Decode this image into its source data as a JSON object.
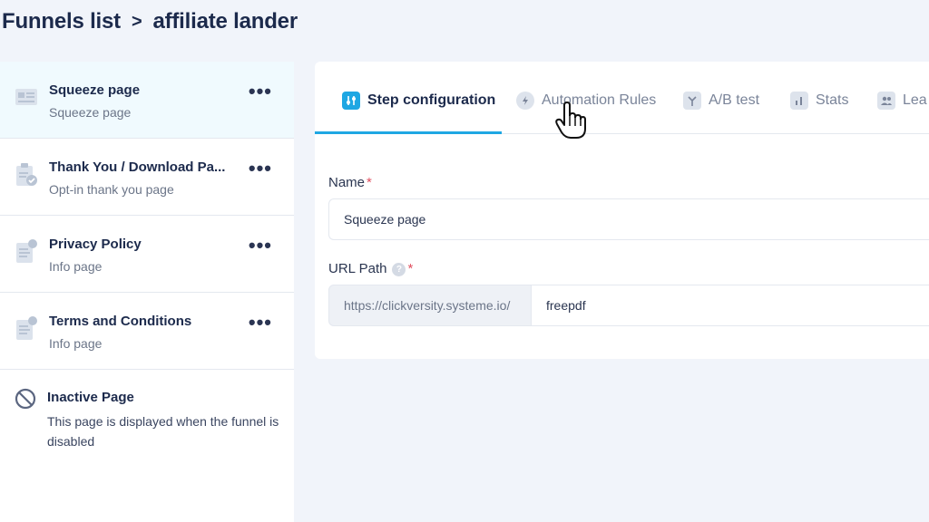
{
  "breadcrumb": {
    "root": "Funnels list",
    "separator": ">",
    "current": "affiliate lander"
  },
  "sidebar": {
    "steps": [
      {
        "title": "Squeeze page",
        "subtitle": "Squeeze page",
        "icon": "page-layout-icon",
        "menu": "•••"
      },
      {
        "title": "Thank You / Download Pa...",
        "subtitle": "Opt-in thank you page",
        "icon": "clipboard-check-icon",
        "menu": "•••"
      },
      {
        "title": "Privacy Policy",
        "subtitle": "Info page",
        "icon": "document-info-icon",
        "menu": "•••"
      },
      {
        "title": "Terms and Conditions",
        "subtitle": "Info page",
        "icon": "document-info-icon",
        "menu": "•••"
      }
    ],
    "inactive": {
      "title": "Inactive Page",
      "description": "This page is displayed when the funnel is disabled",
      "icon": "ban-icon"
    }
  },
  "tabs": [
    {
      "label": "Step configuration",
      "icon": "sliders-icon",
      "active": true
    },
    {
      "label": "Automation Rules",
      "icon": "bolt-icon",
      "active": false
    },
    {
      "label": "A/B test",
      "icon": "split-icon",
      "active": false
    },
    {
      "label": "Stats",
      "icon": "bar-chart-icon",
      "active": false
    },
    {
      "label": "Lea",
      "icon": "users-icon",
      "active": false
    }
  ],
  "form": {
    "name_label": "Name",
    "name_value": "Squeeze page",
    "url_label": "URL Path",
    "url_prefix": "https://clickversity.systeme.io/",
    "url_value": "freepdf",
    "required_mark": "*",
    "help_mark": "?"
  },
  "colors": {
    "accent": "#1ea7e3",
    "required": "#e04f5f",
    "active_step_bg": "#f0fafe"
  }
}
